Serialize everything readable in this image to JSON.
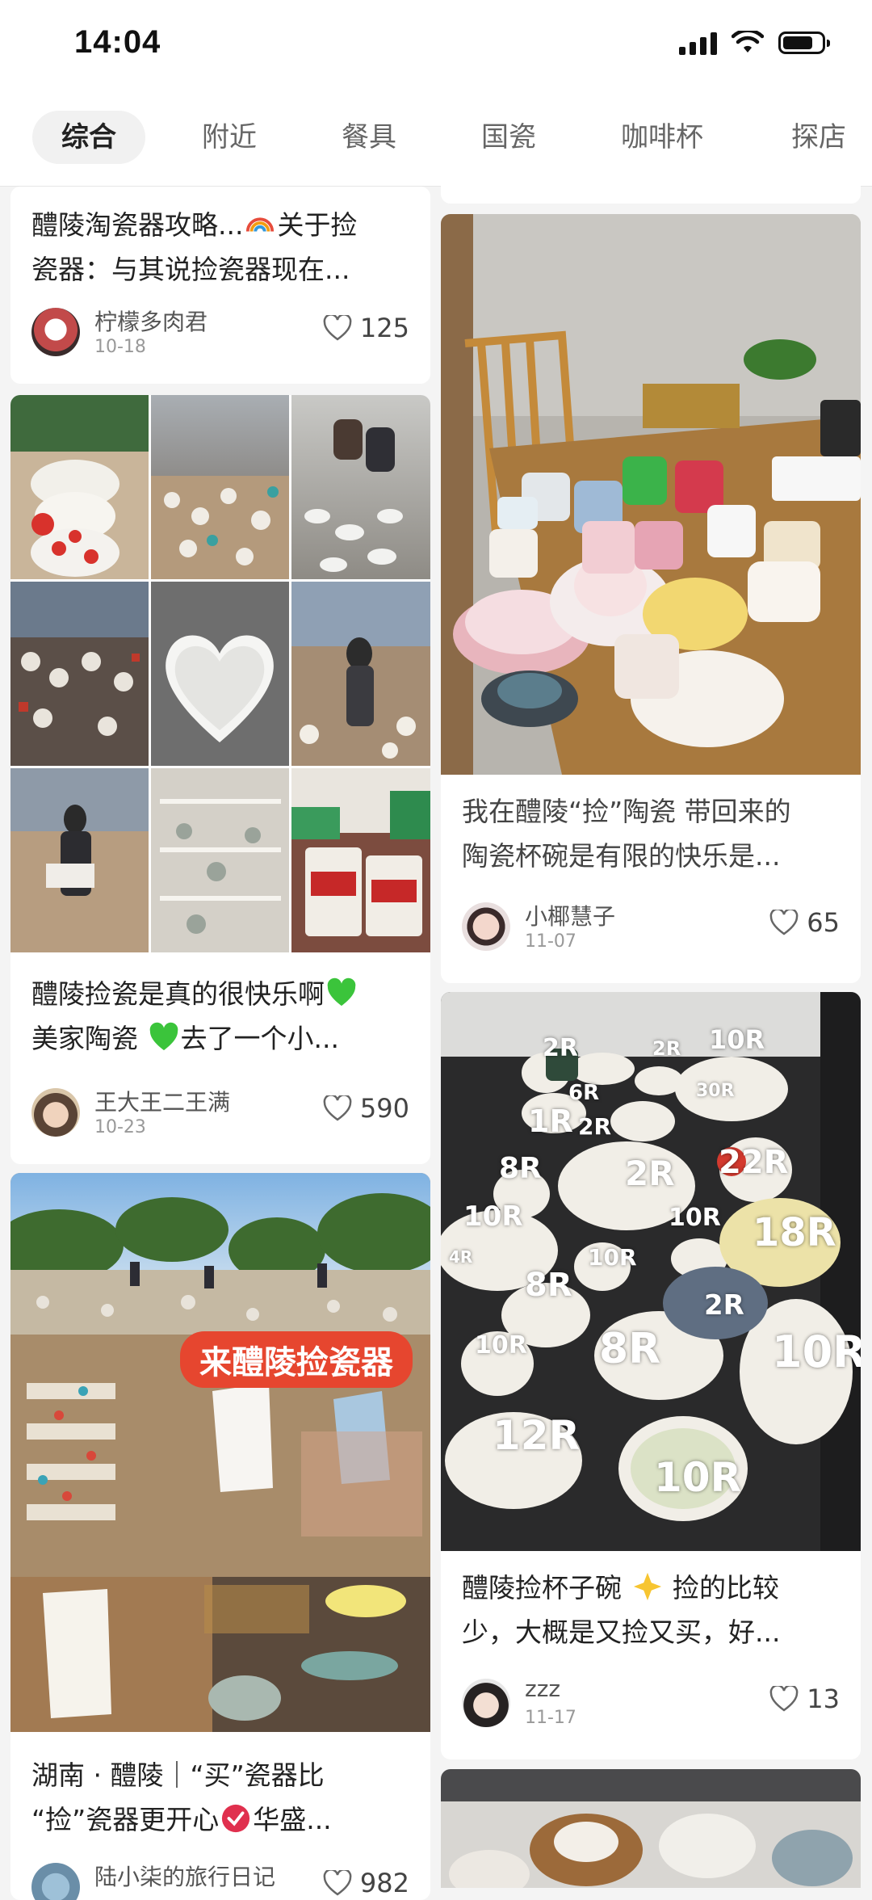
{
  "status_bar": {
    "time": "14:04"
  },
  "tabs": [
    {
      "label": "综合",
      "active": true
    },
    {
      "label": "附近"
    },
    {
      "label": "餐具"
    },
    {
      "label": "国瓷"
    },
    {
      "label": "咖啡杯"
    },
    {
      "label": "探店"
    }
  ],
  "feed": {
    "left": [
      {
        "title": "醴陵淘瓷器攻略...🌈关于捡瓷器：与其说捡瓷器现在...",
        "title_a": "醴陵淘瓷器攻略...",
        "title_b": "关于捡",
        "title_line2": "瓷器：与其说捡瓷器现在...",
        "author": "柠檬多肉君",
        "date": "10-18",
        "likes": "125"
      },
      {
        "title_line1a": "醴陵捡瓷是真的很快乐啊",
        "title_line2a": "美家陶瓷",
        "title_line2b": "去了一个小...",
        "author": "王大王二王满",
        "date": "10-23",
        "likes": "590"
      },
      {
        "banner": "来醴陵捡瓷器",
        "title_line1": "湖南 · 醴陵｜“买”瓷器比",
        "title_line2a": "“捡”瓷器更开心",
        "title_line2b": "华盛...",
        "author": "陆小柒的旅行日记",
        "likes": "982"
      }
    ],
    "right": [
      {
        "title_line1": "我在醴陵“捡”陶瓷 带回来的",
        "title_line2": "陶瓷杯碗是有限的快乐是...",
        "author": "小椰慧子",
        "date": "11-07",
        "likes": "65"
      },
      {
        "title_line1a": "醴陵捡杯子碗",
        "title_line1b": "捡的比较",
        "title_line2": "少，大概是又捡又买，好...",
        "author": "zzz",
        "date": "11-17",
        "likes": "13"
      }
    ]
  },
  "price_tags": [
    "2R",
    "2R",
    "10R",
    "6R",
    "30R",
    "1R",
    "2R",
    "2R",
    "22R",
    "8R",
    "10R",
    "10R",
    "18R",
    "4R",
    "10R",
    "8R",
    "2R",
    "10R",
    "8R",
    "10R",
    "12R",
    "10R"
  ]
}
